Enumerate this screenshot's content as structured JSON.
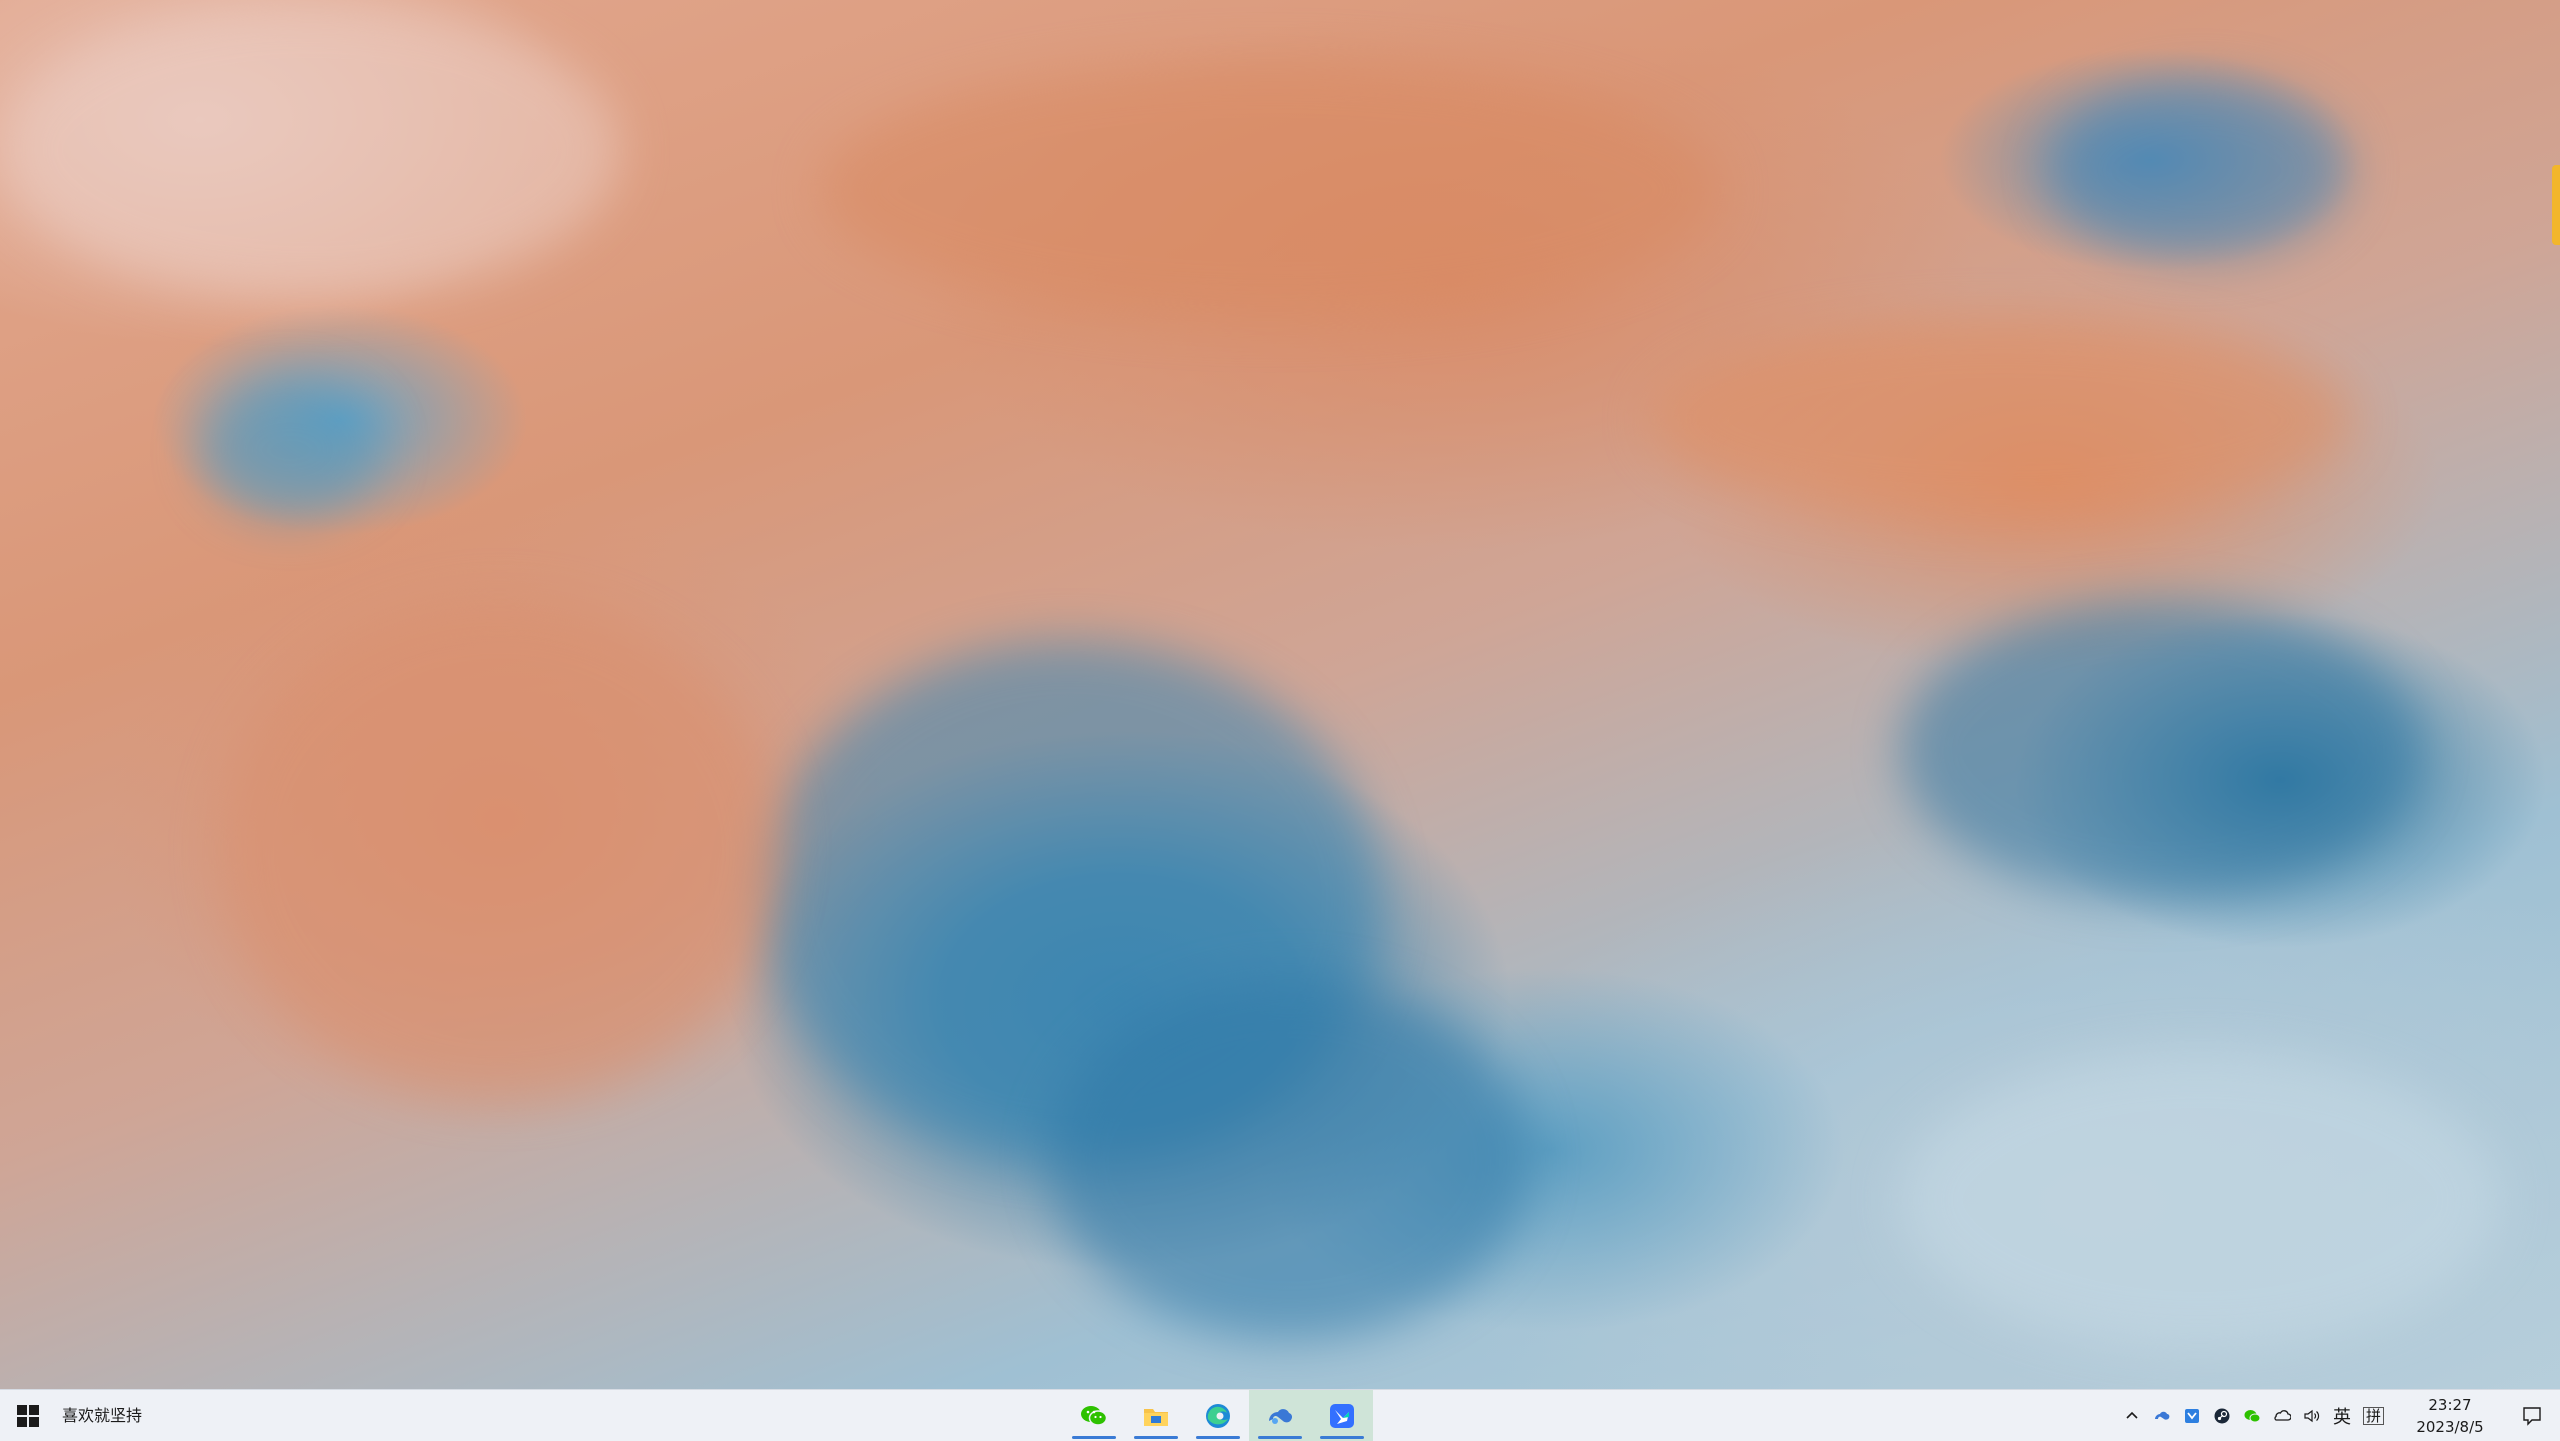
{
  "desktop": {
    "wallpaper": "fluid-art-orange-blue",
    "accent_colors": [
      "#d98d6a",
      "#3f87b0",
      "#c9d7e2"
    ]
  },
  "taskbar": {
    "start_icon": "windows-logo-icon",
    "search_hint": "喜欢就坚持",
    "pinned_apps": [
      {
        "name": "wechat-icon",
        "active": false
      },
      {
        "name": "file-explorer-icon",
        "active": false
      },
      {
        "name": "edge-browser-icon",
        "active": false
      },
      {
        "name": "baidu-netdisk-icon",
        "active": true
      },
      {
        "name": "feishu-icon",
        "active": true
      }
    ],
    "tray": {
      "show_hidden_icon": "chevron-up-icon",
      "icons": [
        "baidu-cloud-tray-icon",
        "security-tray-icon",
        "steam-tray-icon",
        "wechat-tray-icon",
        "onedrive-icon",
        "volume-icon"
      ],
      "language": "英",
      "ime": "拼",
      "time": "23:27",
      "date": "2023/8/5",
      "notification_icon": "notification-icon"
    }
  }
}
